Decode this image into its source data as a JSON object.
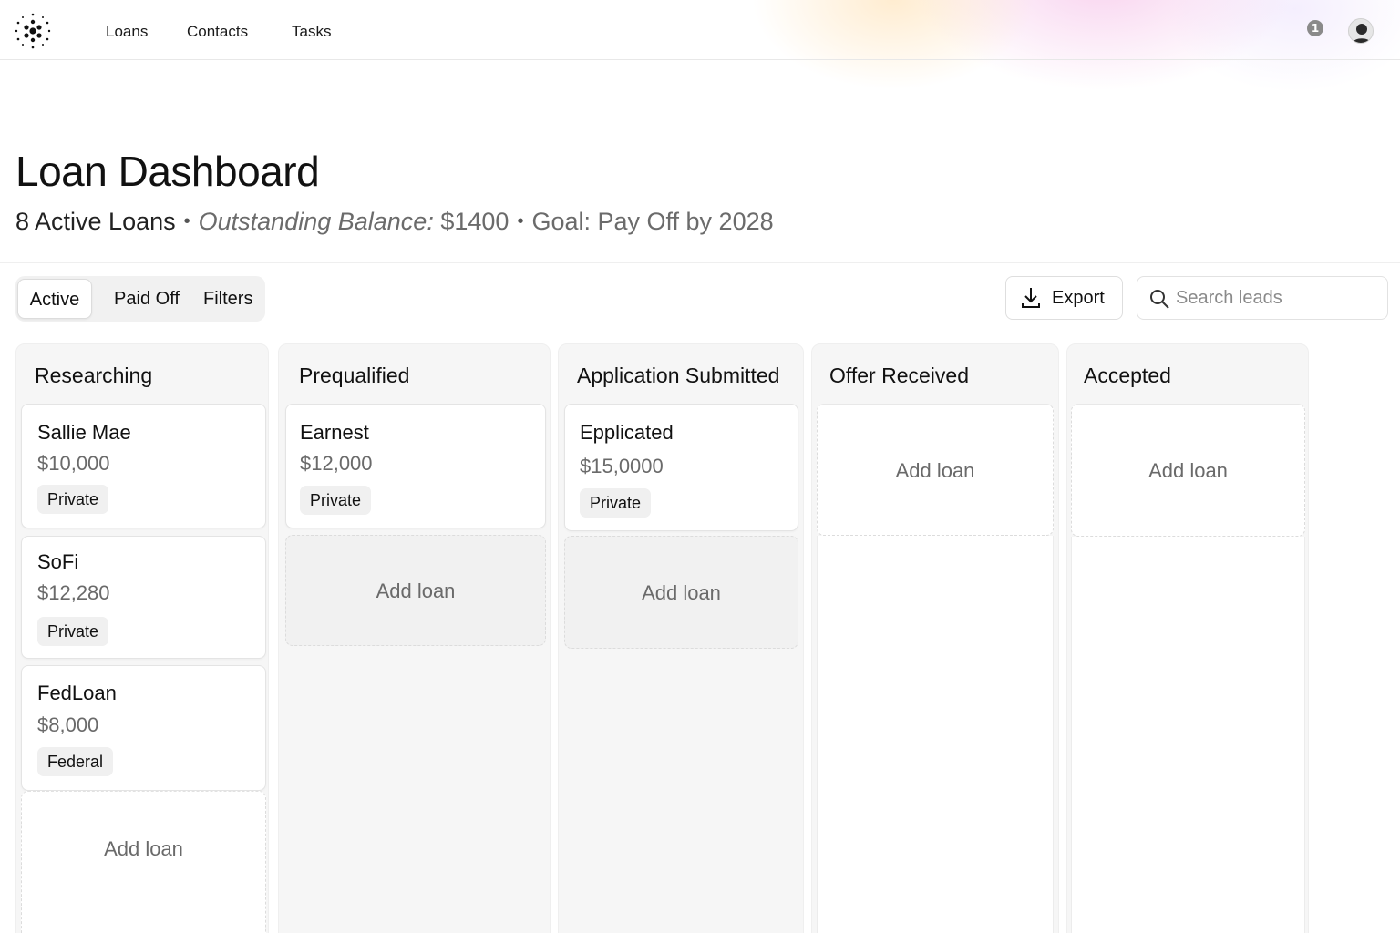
{
  "nav": {
    "links": [
      "Loans",
      "Contacts",
      "Tasks"
    ],
    "notification_count": "1",
    "logo_icon": "dotted-circle-logo",
    "avatar_icon": "user-avatar"
  },
  "header": {
    "title": "Loan Dashboard",
    "active_count": "8 Active Loans",
    "balance_label": "Outstanding Balance:",
    "balance_value": "$1400",
    "goal": "Goal: Pay Off by 2028"
  },
  "toolbar": {
    "tabs": [
      "Active",
      "Paid Off",
      "Filters"
    ],
    "selected_tab": "Active",
    "export_label": "Export",
    "export_icon": "download-icon",
    "search_placeholder": "Search leads",
    "search_icon": "search-icon"
  },
  "board": {
    "add_label": "Add loan",
    "columns": [
      {
        "title": "Researching",
        "cards": [
          {
            "name": "Sallie Mae",
            "amount": "$10,000",
            "type": "Private"
          },
          {
            "name": "SoFi",
            "amount": "$12,280",
            "type": "Private"
          },
          {
            "name": "FedLoan",
            "amount": "$8,000",
            "type": "Federal"
          }
        ]
      },
      {
        "title": "Prequalified",
        "cards": [
          {
            "name": "Earnest",
            "amount": "$12,000",
            "type": "Private"
          }
        ]
      },
      {
        "title": "Application Submitted",
        "cards": [
          {
            "name": "Epplicated",
            "amount": "$15,0000",
            "type": "Private"
          }
        ]
      },
      {
        "title": "Offer Received",
        "cards": []
      },
      {
        "title": "Accepted",
        "cards": []
      }
    ]
  },
  "colors": {
    "text": "#111111",
    "muted": "#6a6a6a",
    "column_bg": "#f6f6f6",
    "tag_bg": "#f0f0f0"
  }
}
